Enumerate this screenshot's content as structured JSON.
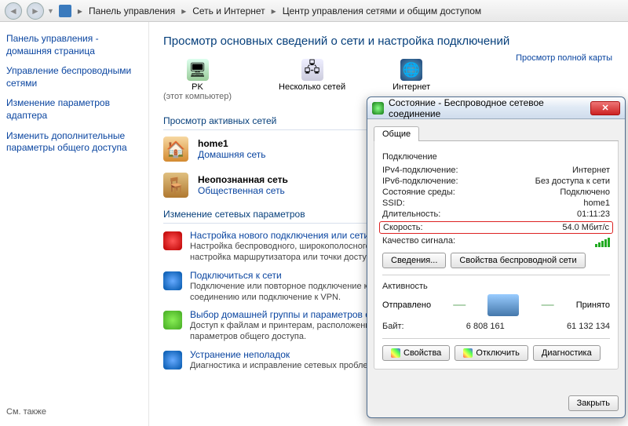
{
  "breadcrumb": {
    "item1": "Панель управления",
    "item2": "Сеть и Интернет",
    "item3": "Центр управления сетями и общим доступом"
  },
  "sidebar": {
    "link_home": "Панель управления - домашняя страница",
    "link_wireless": "Управление беспроводными сетями",
    "link_adapter": "Изменение параметров адаптера",
    "link_sharing": "Изменить дополнительные параметры общего доступа",
    "see_also": "См. также"
  },
  "page": {
    "title": "Просмотр основных сведений о сети и настройка подключений",
    "full_map": "Просмотр полной карты",
    "map_pc": "PK",
    "map_pc_sub": "(этот компьютер)",
    "map_multi": "Несколько сетей",
    "map_internet": "Интернет",
    "section_active": "Просмотр активных сетей",
    "net1_name": "home1",
    "net1_type": "Домашняя сеть",
    "net2_name": "Неопознанная сеть",
    "net2_type": "Общественная сеть",
    "section_params": "Изменение сетевых параметров",
    "task1_title": "Настройка нового подключения или сети",
    "task1_desc": "Настройка беспроводного, широкополосного, модемного, прямого или VPN-подключения или же настройка маршрутизатора или точки доступа.",
    "task2_title": "Подключиться к сети",
    "task2_desc": "Подключение или повторное подключение к беспроводному, проводному, модемному сетевому соединению или подключение к VPN.",
    "task3_title": "Выбор домашней группы и параметров общего доступа",
    "task3_desc": "Доступ к файлам и принтерам, расположенным на других сетевых компьютерах, или изменение параметров общего доступа.",
    "task4_title": "Устранение неполадок",
    "task4_desc": "Диагностика и исправление сетевых проблем или получение сведений об исправлении."
  },
  "dialog": {
    "title": "Состояние - Беспроводное сетевое соединение",
    "tab_general": "Общие",
    "grp_connection": "Подключение",
    "ipv4_k": "IPv4-подключение:",
    "ipv4_v": "Интернет",
    "ipv6_k": "IPv6-подключение:",
    "ipv6_v": "Без доступа к сети",
    "media_k": "Состояние среды:",
    "media_v": "Подключено",
    "ssid_k": "SSID:",
    "ssid_v": "home1",
    "dur_k": "Длительность:",
    "dur_v": "01:11:23",
    "speed_k": "Скорость:",
    "speed_v": "54.0 Мбит/с",
    "signal_k": "Качество сигнала:",
    "btn_details": "Сведения...",
    "btn_wprops": "Свойства беспроводной сети",
    "grp_activity": "Активность",
    "sent_label": "Отправлено",
    "recv_label": "Принято",
    "bytes_k": "Байт:",
    "bytes_sent": "6 808 161",
    "bytes_recv": "61 132 134",
    "btn_props": "Свойства",
    "btn_disable": "Отключить",
    "btn_diag": "Диагностика",
    "btn_close": "Закрыть"
  }
}
